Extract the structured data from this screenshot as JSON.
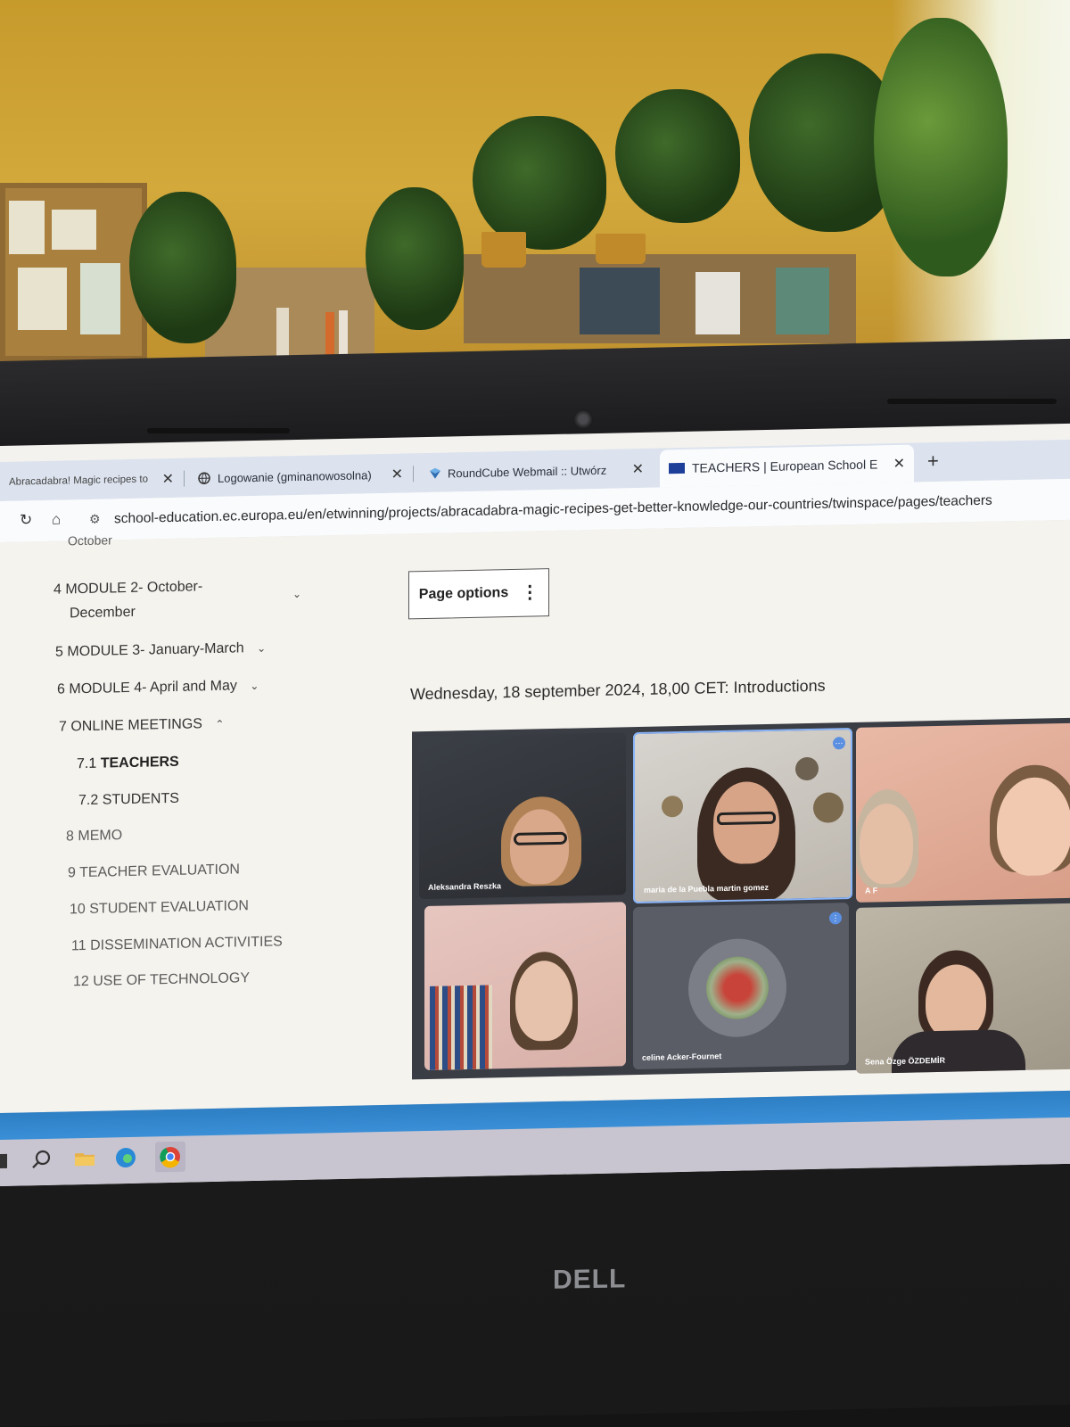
{
  "tabs": [
    {
      "label": "Abracadabra! Magic recipes to",
      "icon": "page-icon",
      "close": "✕"
    },
    {
      "label": "Logowanie (gminanowosolna)",
      "icon": "globe-icon",
      "close": "✕"
    },
    {
      "label": "RoundCube Webmail :: Utwórz",
      "icon": "roundcube-icon",
      "close": "✕"
    },
    {
      "label": "TEACHERS | European School E",
      "icon": "eu-flag-icon",
      "close": "✕"
    }
  ],
  "new_tab": "+",
  "address_bar": {
    "url": "school-education.ec.europa.eu/en/etwinning/projects/abracadabra-magic-recipes-get-better-knowledge-our-countries/twinspace/pages/teachers"
  },
  "sidebar": {
    "cut_item": "October",
    "items": [
      {
        "num": "4",
        "label": "MODULE 2- October-",
        "label2": "December"
      },
      {
        "num": "5",
        "label": "MODULE 3- January-March"
      },
      {
        "num": "6",
        "label": "MODULE 4- April and May"
      },
      {
        "num": "7",
        "label": "ONLINE MEETINGS"
      },
      {
        "num": "7.1",
        "label": "TEACHERS"
      },
      {
        "num": "7.2",
        "label": "STUDENTS"
      },
      {
        "num": "8",
        "label": "MEMO"
      },
      {
        "num": "9",
        "label": "TEACHER EVALUATION"
      },
      {
        "num": "10",
        "label": "STUDENT EVALUATION"
      },
      {
        "num": "11",
        "label": "DISSEMINATION ACTIVITIES"
      },
      {
        "num": "12",
        "label": "USE OF TECHNOLOGY"
      }
    ]
  },
  "main": {
    "page_options": "Page options",
    "meeting_heading": "Wednesday, 18 september 2024, 18,00 CET: Introductions"
  },
  "video_participants": [
    {
      "name": "Aleksandra Reszka"
    },
    {
      "name": "maria de la Puebla martin gomez"
    },
    {
      "name": "A F"
    },
    {
      "name": ""
    },
    {
      "name": "celine Acker-Fournet"
    },
    {
      "name": "Sena Özge ÖZDEMİR"
    }
  ],
  "taskbar_icons": [
    "windows-icon",
    "search-icon",
    "file-explorer-icon",
    "edge-icon",
    "chrome-icon"
  ],
  "brand": "DELL",
  "colors": {
    "taskbar_accent": "#3a8fd6",
    "active_tile_border": "#8ab4f8"
  }
}
